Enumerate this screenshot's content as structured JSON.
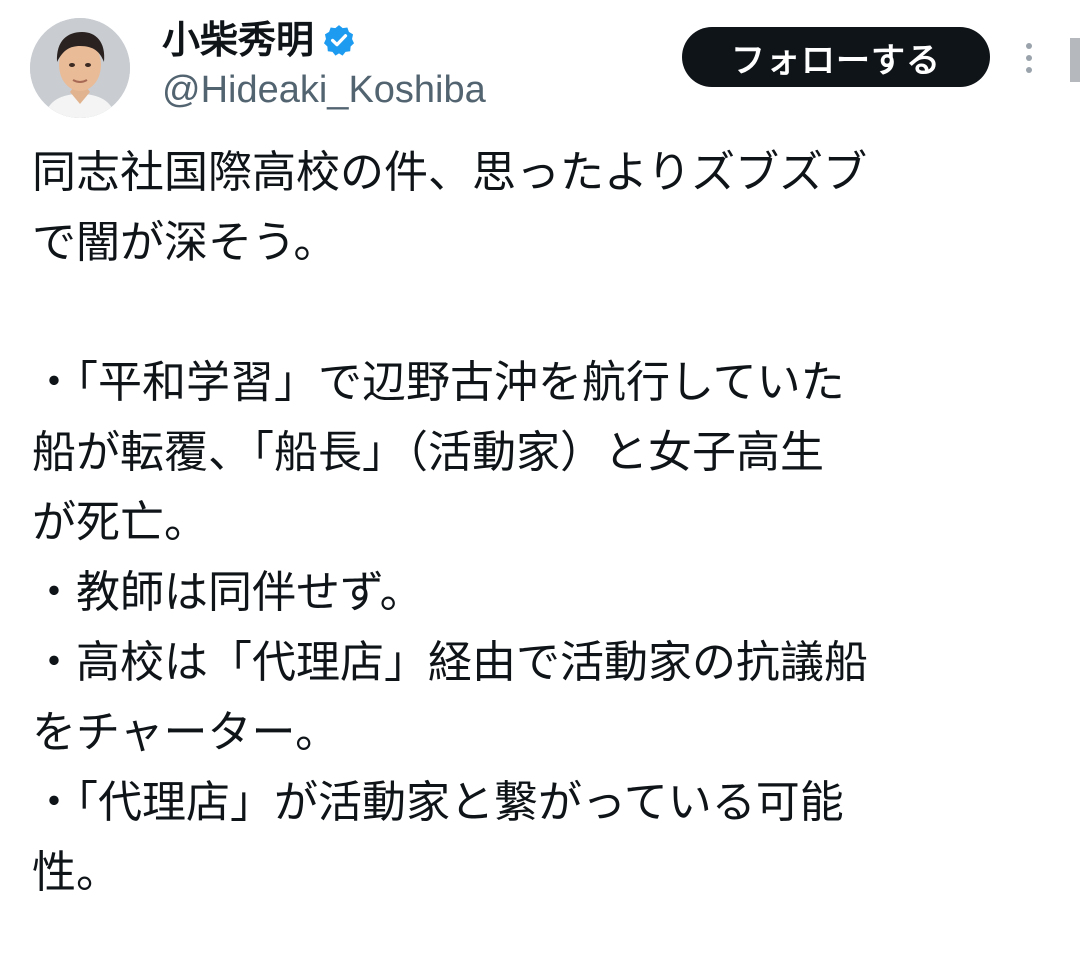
{
  "author": {
    "display_name": "小柴秀明",
    "handle": "@Hideaki_Koshiba",
    "verified_icon": "verified-badge-icon",
    "verified_color": "#1d9bf0"
  },
  "actions": {
    "follow_label": "フォローする",
    "more_icon": "more-vertical-icon"
  },
  "tweet": {
    "lines": [
      "同志社国際高校の件、思ったよりズブズブ",
      "で闇が深そう。",
      "",
      "・「平和学習」で辺野古沖を航行していた",
      "船が転覆、「船長」（活動家）と女子高生",
      "が死亡。",
      "・教師は同伴せず。",
      "・高校は「代理店」経由で活動家の抗議船",
      "をチャーター。",
      "・「代理店」が活動家と繋がっている可能",
      "性。"
    ]
  }
}
